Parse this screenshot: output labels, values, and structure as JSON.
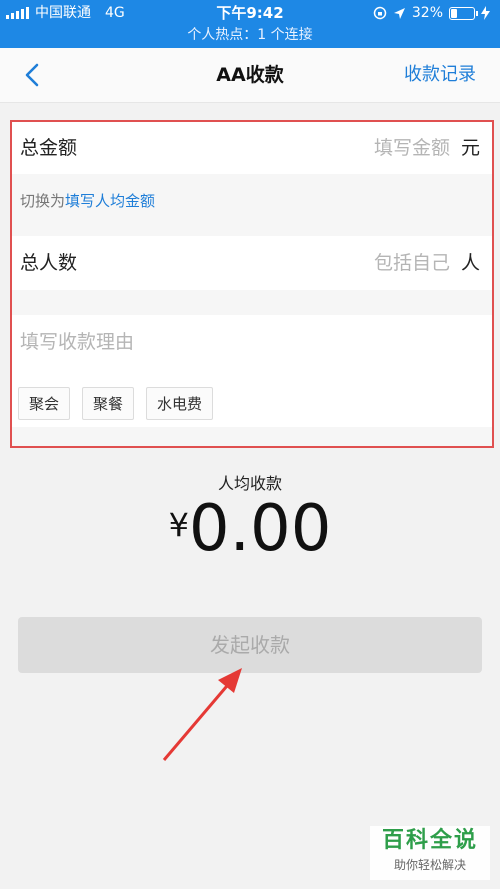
{
  "status_bar": {
    "carrier": "中国联通",
    "network": "4G",
    "time": "下午9:42",
    "battery": "32%",
    "battery_level": 0.32,
    "hotspot": "个人热点：1 个连接"
  },
  "nav": {
    "back_icon": "chevron-left-icon",
    "title": "AA收款",
    "right_link": "收款记录"
  },
  "form": {
    "total_amount_label": "总金额",
    "total_amount_placeholder": "填写金额",
    "total_amount_unit": "元",
    "switch_prefix": "切换为",
    "switch_link": "填写人均金额",
    "people_label": "总人数",
    "people_placeholder": "包括自己",
    "people_unit": "人",
    "reason_placeholder": "填写收款理由",
    "tags": [
      "聚会",
      "聚餐",
      "水电费"
    ]
  },
  "summary": {
    "per_person_label": "人均收款",
    "currency": "¥",
    "amount": "0.00"
  },
  "submit_label": "发起收款",
  "watermark": {
    "title": "百科全说",
    "subtitle": "助你轻松解决"
  },
  "colors": {
    "status_bar": "#1e88e5",
    "link": "#1f7ed8",
    "highlight_border": "#e05050",
    "arrow": "#e53935",
    "watermark": "#2e9e4a"
  }
}
